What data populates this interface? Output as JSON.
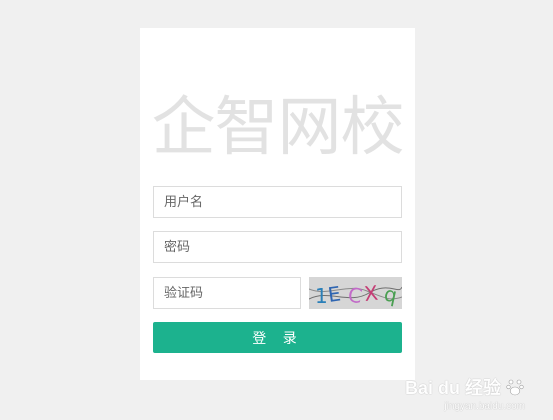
{
  "brand": {
    "title": "企智网校"
  },
  "form": {
    "username_placeholder": "用户名",
    "password_placeholder": "密码",
    "captcha_placeholder": "验证码",
    "captcha_text": "1ECXq",
    "login_label": "登 录"
  },
  "watermark": {
    "brand": "Bai du 经验",
    "url": "jingyan.baidu.com"
  },
  "colors": {
    "page_bg": "#f0f0f0",
    "card_bg": "#ffffff",
    "title": "#e2e2e2",
    "primary": "#1cb28e"
  }
}
